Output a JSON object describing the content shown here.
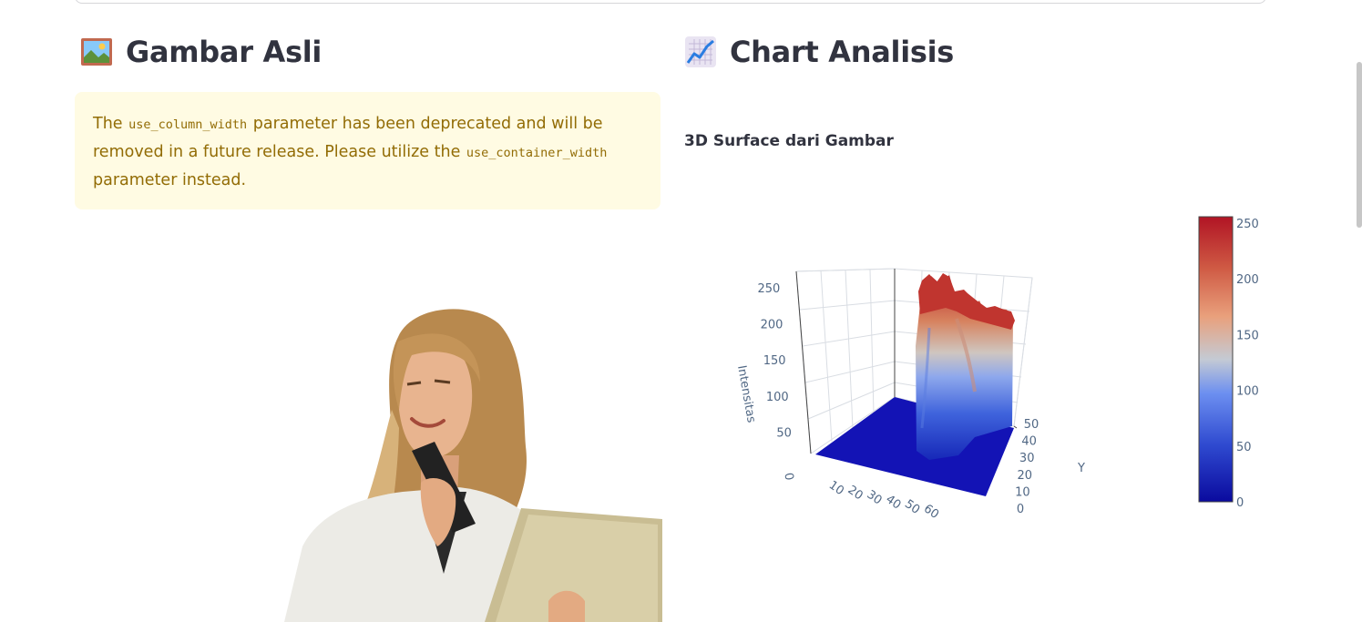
{
  "left_column": {
    "heading_icon": "framed-picture-icon",
    "heading": "Gambar Asli",
    "alert": {
      "part1": "The ",
      "code1": "use_column_width",
      "part2": " parameter has been deprecated and will be removed in a future release. Please utilize the ",
      "code2": "use_container_width",
      "part3": " parameter instead.",
      "color": "#926c05",
      "background": "#fffbe3"
    },
    "image_alt": "woman holding phone and tablet"
  },
  "right_column": {
    "heading_icon": "chart-increasing-icon",
    "heading": "Chart Analisis",
    "subtitle": "3D Surface dari Gambar"
  },
  "chart_data": {
    "type": "surface",
    "z_axis_label": "Intensitas",
    "y_axis_label": "Y",
    "x_axis_label": "",
    "z_ticks": [
      "250",
      "200",
      "150",
      "100",
      "50",
      "0"
    ],
    "x_ticks": [
      "0",
      "10",
      "20",
      "30",
      "40",
      "50",
      "60"
    ],
    "y_ticks": [
      "50",
      "40",
      "30",
      "20",
      "10",
      "0"
    ],
    "colorbar_ticks": [
      "250",
      "200",
      "150",
      "100",
      "50",
      "0"
    ],
    "zlim": [
      0,
      255
    ],
    "colorscale": [
      "#0a0aa0",
      "#3b4cc0",
      "#6a8df0",
      "#bfc9d9",
      "#e09b72",
      "#c9513d",
      "#b40426"
    ]
  }
}
